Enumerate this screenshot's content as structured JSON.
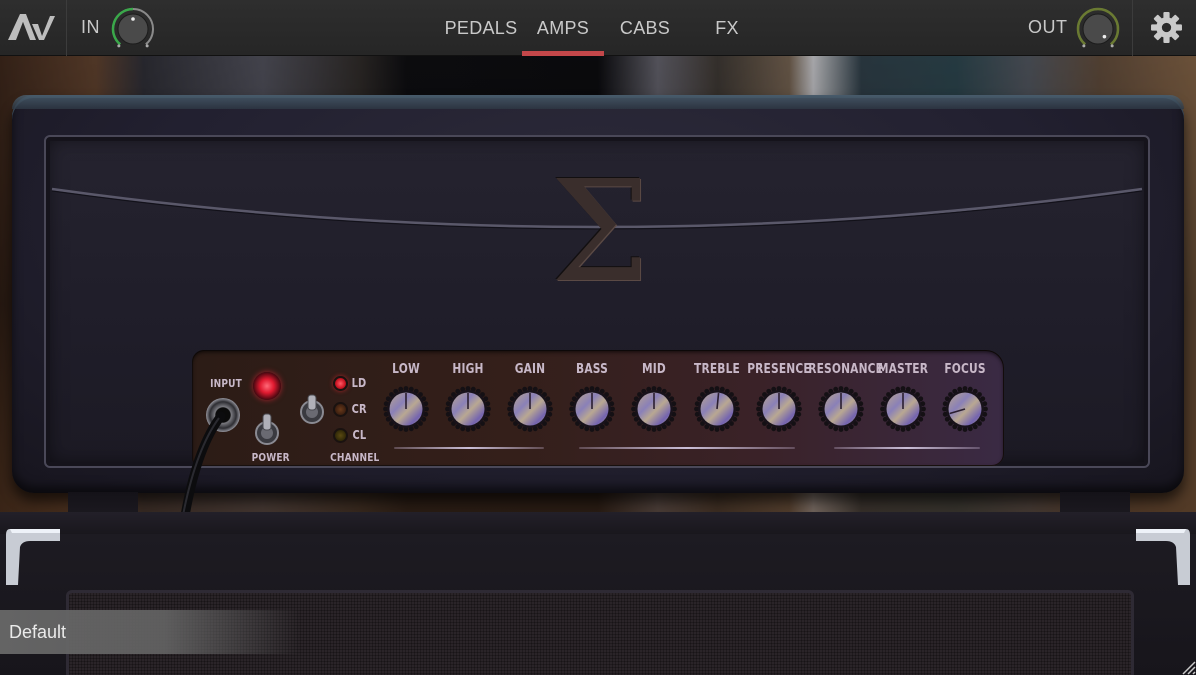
{
  "topbar": {
    "logo": "AV",
    "input": {
      "label": "IN",
      "level": 0.5,
      "arc_color": "#3aa84a"
    },
    "output": {
      "label": "OUT",
      "level": 1.0,
      "arc_color": "#6a7a32"
    },
    "tabs": [
      {
        "label": "PEDALS",
        "active": false
      },
      {
        "label": "AMPS",
        "active": true
      },
      {
        "label": "CABS",
        "active": false
      },
      {
        "label": "FX",
        "active": false
      }
    ],
    "accent": "#c4474a",
    "settings_icon": "gear-icon"
  },
  "amp": {
    "logo_glyph": "Σ",
    "input_label": "INPUT",
    "power_label": "POWER",
    "power_on": true,
    "channel_label": "CHANNEL",
    "channels": [
      {
        "label": "LD",
        "active": true
      },
      {
        "label": "CR",
        "active": false
      },
      {
        "label": "CL",
        "active": false
      }
    ],
    "knobs": [
      {
        "label": "LOW",
        "value": 0.5
      },
      {
        "label": "HIGH",
        "value": 0.5
      },
      {
        "label": "GAIN",
        "value": 0.5
      },
      {
        "label": "BASS",
        "value": 0.5
      },
      {
        "label": "MID",
        "value": 0.5
      },
      {
        "label": "TREBLE",
        "value": 0.52
      },
      {
        "label": "PRESENCE",
        "value": 0.5
      },
      {
        "label": "RESONANCE",
        "value": 0.5
      },
      {
        "label": "MASTER",
        "value": 0.5
      },
      {
        "label": "FOCUS",
        "value": 0.12
      }
    ]
  },
  "preset": {
    "name": "Default"
  }
}
